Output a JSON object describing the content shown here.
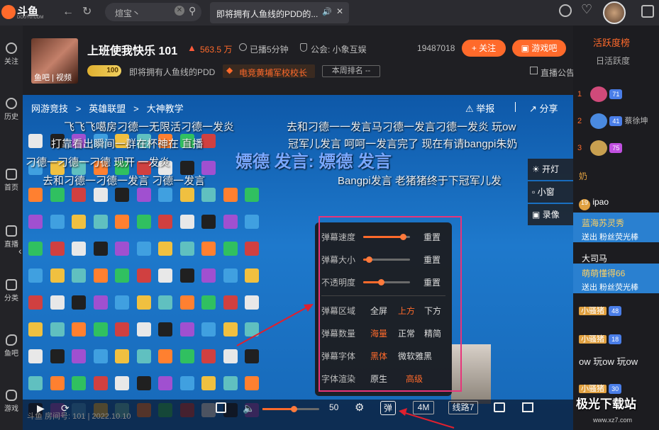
{
  "topbar": {
    "search_placeholder": "煊宝丶",
    "tab_title": "即将拥有人鱼线的PDD的...",
    "logo_text": "斗鱼",
    "logo_sub": "DOUYU.COM"
  },
  "sidebar": [
    {
      "label": "关注",
      "icon": "heart-icon"
    },
    {
      "label": "历史",
      "icon": "clock-icon"
    },
    {
      "label": "首页",
      "icon": "home-icon"
    },
    {
      "label": "直播",
      "icon": "tv-icon"
    },
    {
      "label": "分类",
      "icon": "grid-icon"
    },
    {
      "label": "鱼吧",
      "icon": "fish-icon"
    },
    {
      "label": "游戏",
      "icon": "gamepad-icon"
    }
  ],
  "room": {
    "name": "上班使我快乐 101",
    "heat": "563.5 万",
    "duration": "已播5分钟",
    "guild": "公会: 小象互娱",
    "room_id": "19487018",
    "follow": "关注",
    "game_bar": "游戏吧",
    "avatar_tag": "鱼吧 | 视频",
    "level": "100",
    "subtitle": "即将拥有人鱼线的PDD",
    "badge": "电竞黄埔军校校长",
    "rank": "本周排名 --",
    "notice": "直播公告"
  },
  "breadcrumb": [
    "网游竞技",
    ">",
    "英雄联盟",
    ">",
    "大神教学"
  ],
  "video_actions": {
    "report": "举报",
    "share": "分享",
    "light": "开灯",
    "mini": "小窗",
    "record": "录像"
  },
  "danmu": [
    "飞飞飞噶房刁德一无限活刁德一发炎",
    "去和刁德一一发言马刁德一发言刁德一发炎 玩ow",
    "冠军儿发言  呵呵一发言完了  现在有请bangpi朱奶",
    "嫖德  发言: 嫖德  发言",
    "去和刁德一刁德一发言  刁德一发言",
    "Bangpi发言  老猪猪终于下冠军儿发",
    "打靠看出瞬间一群在杯神在 直播",
    "刁德一刁德一刁德  现开  一发炎"
  ],
  "settings": {
    "speed_label": "弹幕速度",
    "speed": 0.85,
    "size_label": "弹幕大小",
    "size": 0.12,
    "opacity_label": "不透明度",
    "opacity": 0.38,
    "reset": "重置",
    "area_label": "弹幕区域",
    "area_opts": [
      "全屏",
      "上方",
      "下方"
    ],
    "area_sel": 1,
    "count_label": "弹幕数量",
    "count_opts": [
      "海量",
      "正常",
      "精简"
    ],
    "count_sel": 0,
    "font_label": "弹幕字体",
    "font_opts": [
      "黑体",
      "微软雅黑"
    ],
    "font_sel": 0,
    "render_label": "字体渲染",
    "render_opts": [
      "原生",
      "高级"
    ],
    "render_sel": 1
  },
  "controls": {
    "volume_value": "50",
    "volume": 0.55,
    "danmu_btn": "弹",
    "bitrate": "4M",
    "line": "线路7",
    "room_footer": "斗鱼 房间号: 101 | 2022.10.10"
  },
  "right": {
    "tab_active": "活跃度榜",
    "tab2": "日活跃度",
    "ranks": [
      {
        "n": "1",
        "lvl": "71"
      },
      {
        "n": "2",
        "lvl": "41",
        "name": "蔡徐坤"
      },
      {
        "n": "3",
        "lvl": "75"
      }
    ],
    "items": [
      {
        "name": "奶"
      },
      {
        "name": "ipao",
        "lvl": "19"
      },
      {
        "name": "蓝海苏灵秀",
        "sub": "送出 粉丝荧光棒"
      },
      {
        "name": "大司马"
      },
      {
        "name": "萌萌懂得66",
        "sub": "送出 粉丝荧光棒"
      },
      {
        "name": "小骚猪",
        "lvl": "48"
      },
      {
        "name": "小骚猪",
        "lvl": "18"
      },
      {
        "name": "ow 玩ow 玩ow"
      },
      {
        "name": "小骚猪",
        "lvl": "30"
      }
    ],
    "watermark": "极光下载站",
    "watermark_url": "www.xz7.com"
  },
  "colors": {
    "accent": "#ff6a2b",
    "highlight_box": "#e8347a",
    "arrow": "#e0202e"
  }
}
